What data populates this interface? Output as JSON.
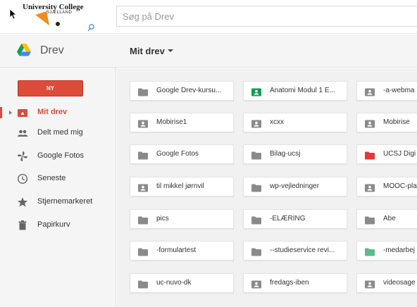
{
  "brand": {
    "name": "University College",
    "sub": "SJÆLLAND"
  },
  "search": {
    "placeholder": "Søg på Drev"
  },
  "app": {
    "name": "Drev"
  },
  "breadcrumb": {
    "current": "Mit drev"
  },
  "sidebar": {
    "new_label": "NY",
    "items": [
      {
        "label": "Mit drev",
        "icon": "my-drive-icon",
        "active": true
      },
      {
        "label": "Delt med mig",
        "icon": "shared-people-icon"
      },
      {
        "label": "Google Fotos",
        "icon": "photos-pinwheel-icon"
      },
      {
        "label": "Seneste",
        "icon": "clock-icon"
      },
      {
        "label": "Stjernemarkeret",
        "icon": "star-icon"
      },
      {
        "label": "Papirkurv",
        "icon": "trash-icon"
      }
    ]
  },
  "colors": {
    "accent": "#dd4b39",
    "folder_gray": "#8a8a8a",
    "folder_green": "#0f9d58",
    "folder_red": "#e53935",
    "folder_lightgreen": "#57bb8a"
  },
  "folders": [
    [
      {
        "name": "Google Drev-kursu...",
        "type": "plain",
        "color": "gray"
      },
      {
        "name": "Anatomi Modul 1 E...",
        "type": "shared",
        "color": "green"
      },
      {
        "name": "-a-webma",
        "type": "shared",
        "color": "gray"
      }
    ],
    [
      {
        "name": "Mobirise1",
        "type": "shared",
        "color": "gray"
      },
      {
        "name": "xcxx",
        "type": "shared",
        "color": "gray"
      },
      {
        "name": "Mobirise",
        "type": "shared",
        "color": "gray"
      }
    ],
    [
      {
        "name": "Google Fotos",
        "type": "plain",
        "color": "gray"
      },
      {
        "name": "Bilag-ucsj",
        "type": "plain",
        "color": "gray"
      },
      {
        "name": "UCSJ Digi",
        "type": "plain",
        "color": "red"
      }
    ],
    [
      {
        "name": "til mikkel jørnvil",
        "type": "shared",
        "color": "gray"
      },
      {
        "name": "wp-vejledninger",
        "type": "plain",
        "color": "gray"
      },
      {
        "name": "MOOC-pla",
        "type": "shared",
        "color": "gray"
      }
    ],
    [
      {
        "name": "pics",
        "type": "plain",
        "color": "gray"
      },
      {
        "name": "-ELÆRING",
        "type": "plain",
        "color": "gray"
      },
      {
        "name": "Abe",
        "type": "plain",
        "color": "gray"
      }
    ],
    [
      {
        "name": "-formulartest",
        "type": "plain",
        "color": "gray"
      },
      {
        "name": "--studieservice revi...",
        "type": "plain",
        "color": "gray"
      },
      {
        "name": "-medarbej",
        "type": "plain",
        "color": "lightgreen"
      }
    ],
    [
      {
        "name": "uc-nuvo-dk",
        "type": "plain",
        "color": "gray"
      },
      {
        "name": "fredags-iben",
        "type": "shared",
        "color": "gray"
      },
      {
        "name": "videosage",
        "type": "shared",
        "color": "gray"
      }
    ]
  ]
}
